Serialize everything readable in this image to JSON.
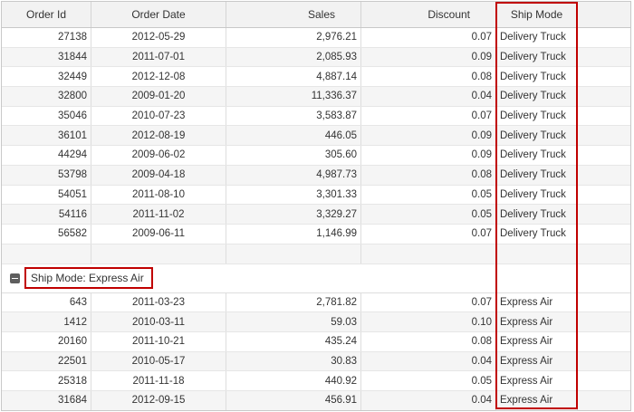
{
  "columns": {
    "order_id": "Order Id",
    "order_date": "Order Date",
    "sales": "Sales",
    "discount": "Discount",
    "ship_mode": "Ship Mode"
  },
  "rows": [
    {
      "order_id": "27138",
      "order_date": "2012-05-29",
      "sales": "2,976.21",
      "discount": "0.07",
      "ship_mode": "Delivery Truck"
    },
    {
      "order_id": "31844",
      "order_date": "2011-07-01",
      "sales": "2,085.93",
      "discount": "0.09",
      "ship_mode": "Delivery Truck"
    },
    {
      "order_id": "32449",
      "order_date": "2012-12-08",
      "sales": "4,887.14",
      "discount": "0.08",
      "ship_mode": "Delivery Truck"
    },
    {
      "order_id": "32800",
      "order_date": "2009-01-20",
      "sales": "11,336.37",
      "discount": "0.04",
      "ship_mode": "Delivery Truck"
    },
    {
      "order_id": "35046",
      "order_date": "2010-07-23",
      "sales": "3,583.87",
      "discount": "0.07",
      "ship_mode": "Delivery Truck"
    },
    {
      "order_id": "36101",
      "order_date": "2012-08-19",
      "sales": "446.05",
      "discount": "0.09",
      "ship_mode": "Delivery Truck"
    },
    {
      "order_id": "44294",
      "order_date": "2009-06-02",
      "sales": "305.60",
      "discount": "0.09",
      "ship_mode": "Delivery Truck"
    },
    {
      "order_id": "53798",
      "order_date": "2009-04-18",
      "sales": "4,987.73",
      "discount": "0.08",
      "ship_mode": "Delivery Truck"
    },
    {
      "order_id": "54051",
      "order_date": "2011-08-10",
      "sales": "3,301.33",
      "discount": "0.05",
      "ship_mode": "Delivery Truck"
    },
    {
      "order_id": "54116",
      "order_date": "2011-11-02",
      "sales": "3,329.27",
      "discount": "0.05",
      "ship_mode": "Delivery Truck"
    },
    {
      "order_id": "56582",
      "order_date": "2009-06-11",
      "sales": "1,146.99",
      "discount": "0.07",
      "ship_mode": "Delivery Truck"
    }
  ],
  "group": {
    "label": "Ship Mode: Express Air",
    "icon": "collapse-icon",
    "rows": [
      {
        "order_id": "643",
        "order_date": "2011-03-23",
        "sales": "2,781.82",
        "discount": "0.07",
        "ship_mode": "Express Air"
      },
      {
        "order_id": "1412",
        "order_date": "2010-03-11",
        "sales": "59.03",
        "discount": "0.10",
        "ship_mode": "Express Air"
      },
      {
        "order_id": "20160",
        "order_date": "2011-10-21",
        "sales": "435.24",
        "discount": "0.08",
        "ship_mode": "Express Air"
      },
      {
        "order_id": "22501",
        "order_date": "2010-05-17",
        "sales": "30.83",
        "discount": "0.04",
        "ship_mode": "Express Air"
      },
      {
        "order_id": "25318",
        "order_date": "2011-11-18",
        "sales": "440.92",
        "discount": "0.05",
        "ship_mode": "Express Air"
      },
      {
        "order_id": "31684",
        "order_date": "2012-09-15",
        "sales": "456.91",
        "discount": "0.04",
        "ship_mode": "Express Air"
      }
    ]
  },
  "colors": {
    "highlight": "#c00000",
    "header_bg": "#f2f2f2",
    "alt_row_bg": "#f5f5f5",
    "grid_border": "#c8c8c8"
  }
}
